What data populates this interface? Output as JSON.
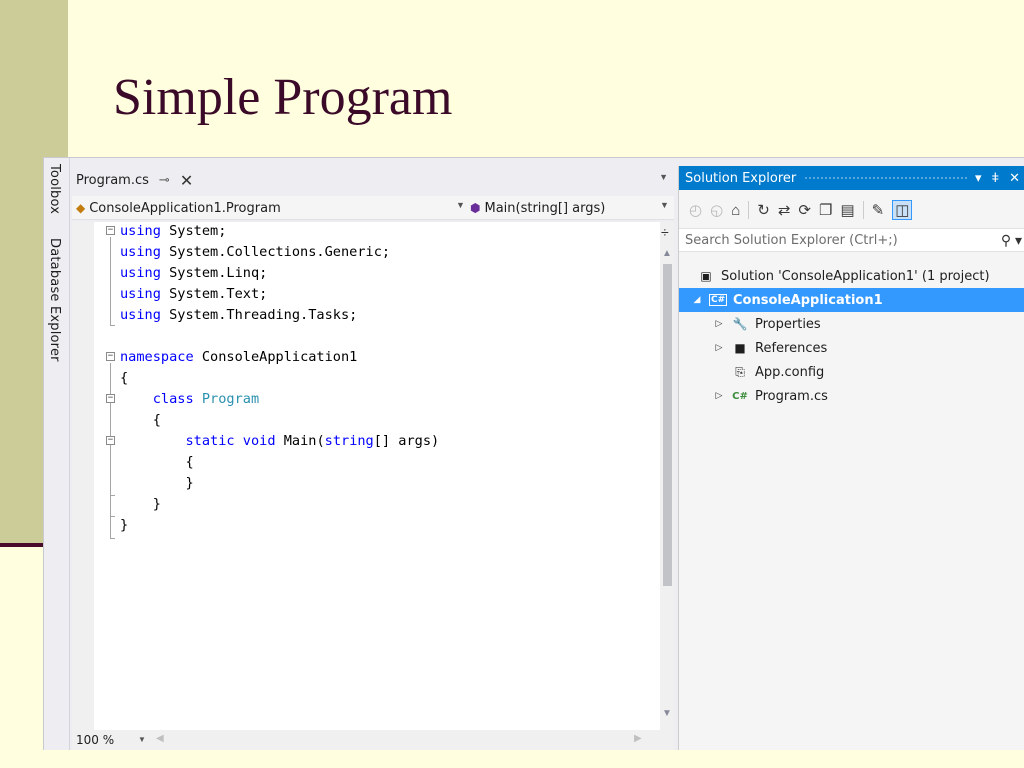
{
  "slide": {
    "title": "Simple Program"
  },
  "side_tabs": [
    "Toolbox",
    "Database Explorer"
  ],
  "editor": {
    "tab": {
      "label": "Program.cs",
      "pin": "⊸",
      "close": "✕"
    },
    "nav": {
      "type_dropdown": "ConsoleApplication1.Program",
      "member_dropdown": "Main(string[] args)"
    },
    "zoom": "100 %"
  },
  "code_lines": [
    [
      {
        "t": "using",
        "c": "kw"
      },
      {
        "t": " System;"
      }
    ],
    [
      {
        "t": "using",
        "c": "kw"
      },
      {
        "t": " System.Collections.Generic;"
      }
    ],
    [
      {
        "t": "using",
        "c": "kw"
      },
      {
        "t": " System.Linq;"
      }
    ],
    [
      {
        "t": "using",
        "c": "kw"
      },
      {
        "t": " System.Text;"
      }
    ],
    [
      {
        "t": "using",
        "c": "kw"
      },
      {
        "t": " System.Threading.Tasks;"
      }
    ],
    [],
    [
      {
        "t": "namespace",
        "c": "kw"
      },
      {
        "t": " ConsoleApplication1"
      }
    ],
    [
      {
        "t": "{"
      }
    ],
    [
      {
        "t": "    "
      },
      {
        "t": "class",
        "c": "kw"
      },
      {
        "t": " "
      },
      {
        "t": "Program",
        "c": "ty"
      }
    ],
    [
      {
        "t": "    {"
      }
    ],
    [
      {
        "t": "        "
      },
      {
        "t": "static",
        "c": "kw"
      },
      {
        "t": " "
      },
      {
        "t": "void",
        "c": "kw"
      },
      {
        "t": " Main("
      },
      {
        "t": "string",
        "c": "kw"
      },
      {
        "t": "[] args)"
      }
    ],
    [
      {
        "t": "        {"
      }
    ],
    [
      {
        "t": "        }"
      }
    ],
    [
      {
        "t": "    }"
      }
    ],
    [
      {
        "t": "}"
      }
    ]
  ],
  "solution_explorer": {
    "title": "Solution Explorer",
    "search_placeholder": "Search Solution Explorer (Ctrl+;)",
    "items": [
      {
        "label": "Solution 'ConsoleApplication1' (1 project)",
        "icon": "solution-icon",
        "twisty": "",
        "level": 0,
        "selected": false
      },
      {
        "label": "ConsoleApplication1",
        "icon": "csharp-project-icon",
        "twisty": "◢",
        "level": 0,
        "selected": true
      },
      {
        "label": "Properties",
        "icon": "wrench-icon",
        "twisty": "▷",
        "level": 1,
        "selected": false
      },
      {
        "label": "References",
        "icon": "references-icon",
        "twisty": "▷",
        "level": 1,
        "selected": false
      },
      {
        "label": "App.config",
        "icon": "config-file-icon",
        "twisty": "",
        "level": 1,
        "selected": false
      },
      {
        "label": "Program.cs",
        "icon": "csharp-file-icon",
        "twisty": "▷",
        "level": 1,
        "selected": false
      }
    ]
  },
  "colors": {
    "accent": "#007acc",
    "selection": "#3399ff",
    "keyword": "#0000ff",
    "type": "#2b91af",
    "slide_title": "#3a0a28"
  }
}
